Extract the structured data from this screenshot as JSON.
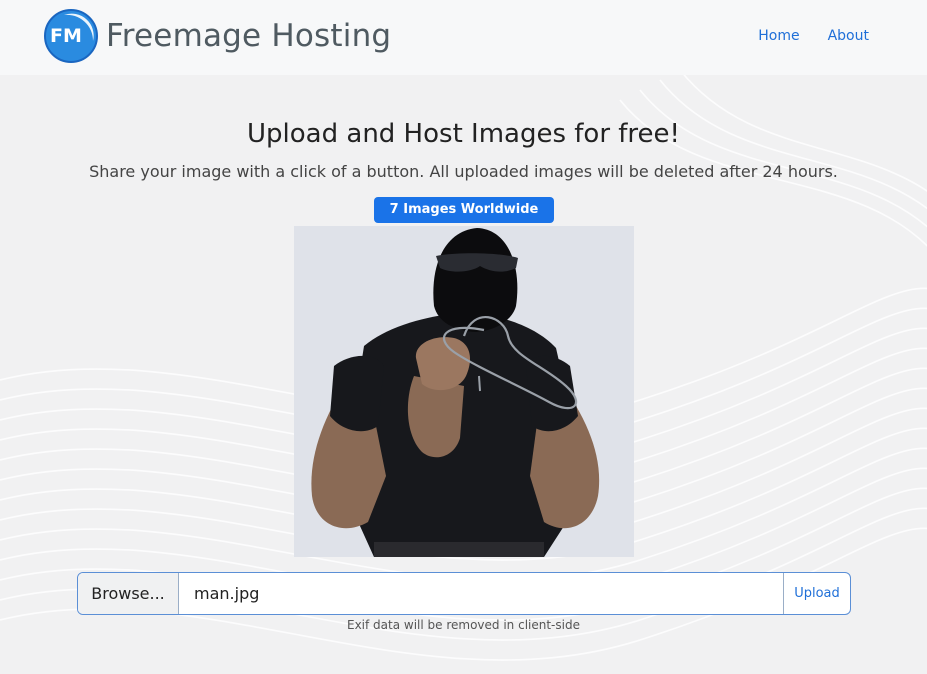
{
  "brand": {
    "logo_text": "FM",
    "name": "Freemage Hosting",
    "logo_icon": "fm-logo-icon"
  },
  "nav": {
    "items": [
      {
        "label": "Home"
      },
      {
        "label": "About"
      }
    ]
  },
  "hero": {
    "title": "Upload and Host Images for free!",
    "subtitle": "Share your image with a click of a button. All uploaded images will be deleted after 24 hours.",
    "badge": "7 Images Worldwide"
  },
  "upload": {
    "browse_label": "Browse...",
    "file_name": "man.jpg",
    "upload_label": "Upload",
    "note": "Exif data will be removed in client-side"
  },
  "colors": {
    "accent": "#1a73e8",
    "link": "#1f6fd8",
    "navbar_bg": "#f7f8f9",
    "page_bg": "#f1f1f2"
  }
}
